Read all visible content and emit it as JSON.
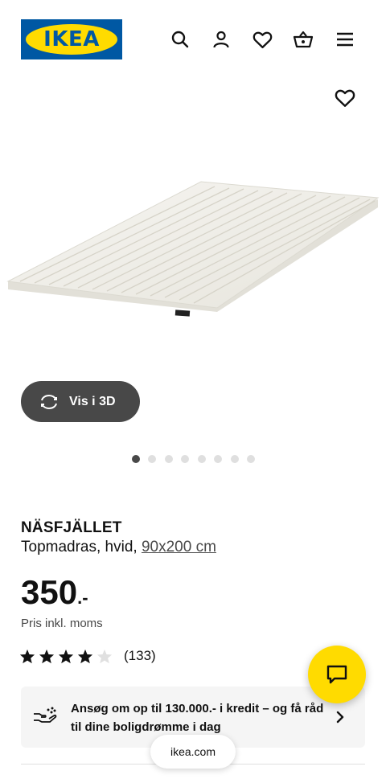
{
  "header": {
    "logo_text": "IKEA",
    "icons": [
      "search-icon",
      "user-icon",
      "heart-icon",
      "basket-icon",
      "menu-icon"
    ]
  },
  "product": {
    "favorite_icon": "heart-icon",
    "view_3d_label": "Vis i 3D",
    "carousel": {
      "total": 8,
      "active": 1
    },
    "name": "NÄSFJÄLLET",
    "description": "Topmadras, hvid,",
    "size": "90x200 cm",
    "price_main": "350",
    "price_suffix": ".-",
    "price_note": "Pris inkl. moms",
    "rating": {
      "stars": 4,
      "max": 5,
      "count": "(133)"
    }
  },
  "credit": {
    "text": "Ansøg om op til 130.000.- i kredit – og få råd til dine boligdrømme i dag"
  },
  "browser": {
    "domain": "ikea.com"
  },
  "colors": {
    "ikea_blue": "#0058a3",
    "ikea_yellow": "#ffdb00",
    "dark_gray": "#484848"
  }
}
